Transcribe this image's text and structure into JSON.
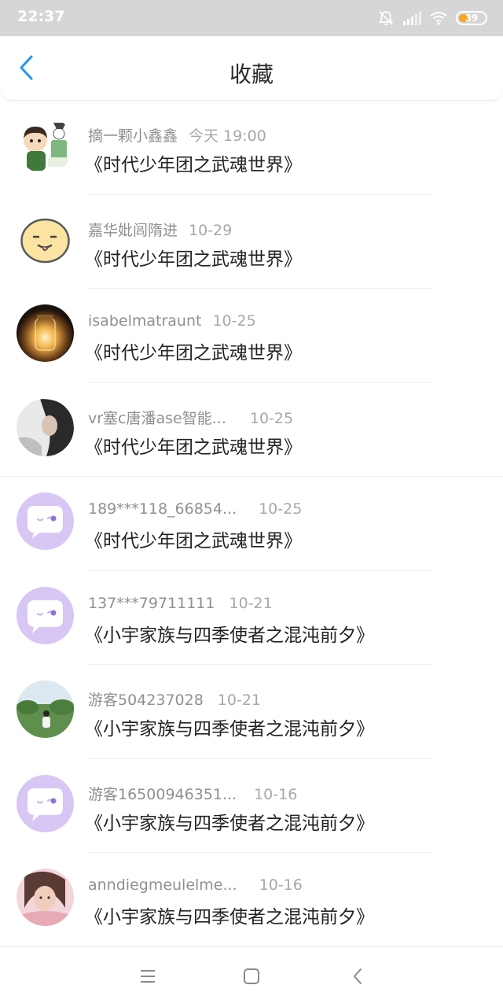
{
  "status_bar": {
    "time": "22:37",
    "battery": "39",
    "battery_level": 0.39,
    "icons": [
      "mute-bell-icon",
      "signal-icon",
      "wifi-icon",
      "battery-icon"
    ]
  },
  "header": {
    "title": "收藏",
    "back_icon": "chevron-left-icon",
    "accent_color": "#2196f3"
  },
  "favorites": [
    {
      "user": "摘一颗小鑫鑫",
      "date": "今天 19:00",
      "title": "《时代少年团之武魂世界》",
      "avatar": "cartoon-boy-avatar"
    },
    {
      "user": "嘉华妣闾隋进",
      "date": "10-29",
      "title": "《时代少年团之武魂世界》",
      "avatar": "smiley-face-avatar"
    },
    {
      "user": "isabelmatraunt",
      "date": "10-25",
      "title": "《时代少年团之武魂世界》",
      "avatar": "jar-light-avatar"
    },
    {
      "user": "vr塞c唐潘ase智能...",
      "date": "10-25",
      "title": "《时代少年团之武魂世界》",
      "avatar": "girl-photo-avatar"
    },
    {
      "user": "189***118_66854...",
      "date": "10-25",
      "title": "《时代少年团之武魂世界》",
      "avatar": "default-chat-avatar"
    },
    {
      "user": "137***79711111",
      "date": "10-21",
      "title": "《小宇家族与四季使者之混沌前夕》",
      "avatar": "default-chat-avatar"
    },
    {
      "user": "游客504237028",
      "date": "10-21",
      "title": "《小宇家族与四季使者之混沌前夕》",
      "avatar": "outdoor-photo-avatar"
    },
    {
      "user": "游客16500946351...",
      "date": "10-16",
      "title": "《小宇家族与四季使者之混沌前夕》",
      "avatar": "default-chat-avatar"
    },
    {
      "user": "anndiegmeulelme...",
      "date": "10-16",
      "title": "《小宇家族与四季使者之混沌前夕》",
      "avatar": "girl-pink-avatar"
    }
  ],
  "system_nav": {
    "menu_icon": "menu-icon",
    "home_icon": "home-square-icon",
    "back_icon": "back-chevron-icon"
  }
}
